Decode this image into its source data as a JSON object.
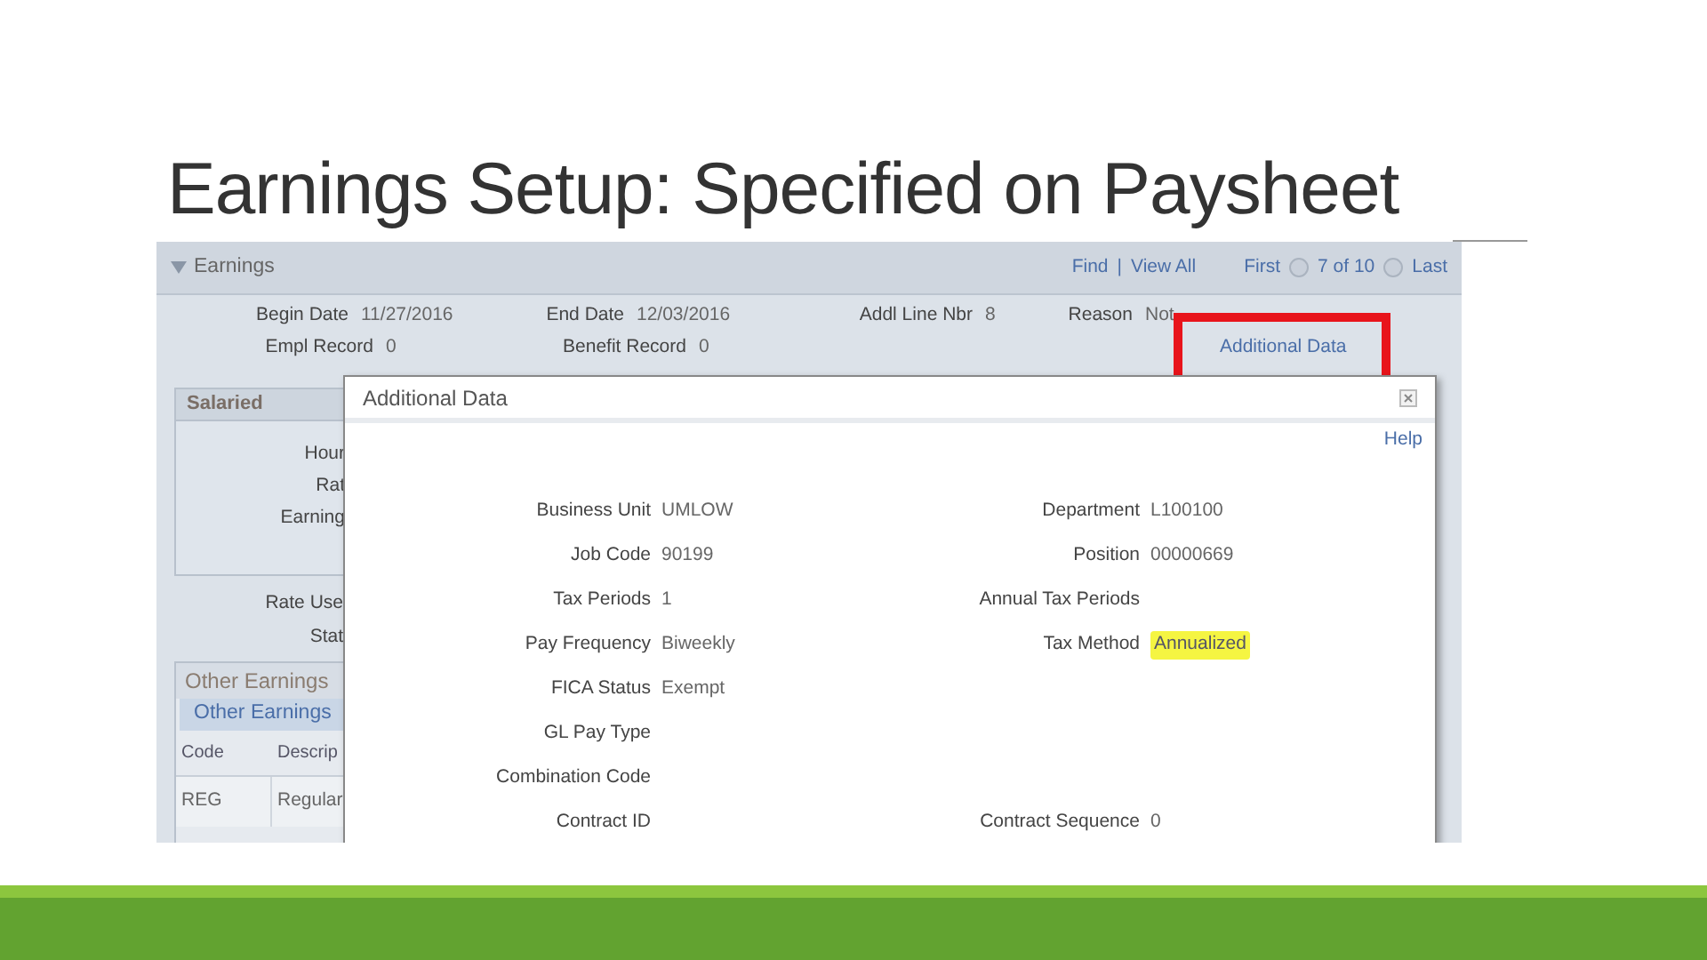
{
  "slide": {
    "title": "Earnings Setup: Specified on Paysheet"
  },
  "screenshot": {
    "section": {
      "title": "Earnings",
      "expanded": true,
      "nav": {
        "find": "Find",
        "separator": "|",
        "view_all": "View All",
        "first": "First",
        "position": "7 of 10",
        "last": "Last"
      }
    },
    "info_rows": [
      [
        {
          "label": "Begin Date",
          "value": "11/27/2016"
        },
        {
          "label": "End Date",
          "value": "12/03/2016"
        },
        {
          "label": "Addl Line Nbr",
          "value": "8"
        },
        {
          "label": "Reason",
          "value": "Not"
        }
      ],
      [
        {
          "label": "Empl Record",
          "value": "0"
        },
        {
          "label": "Benefit Record",
          "value": "0"
        }
      ]
    ],
    "additional_data_link": {
      "label": "Additional Data",
      "annotated": true
    },
    "salaried": {
      "title": "Salaried",
      "labels": [
        "Hour",
        "Rat",
        "Earning"
      ]
    },
    "rate_labels": [
      "Rate Use",
      "Stat"
    ],
    "other_earnings": {
      "title": "Other Earnings",
      "tab": "Other Earnings",
      "columns": [
        "Code",
        "Descrip"
      ],
      "rows": [
        [
          "REG",
          "Regular"
        ]
      ]
    },
    "dialog": {
      "title": "Additional Data",
      "help": "Help",
      "rows": [
        {
          "left": {
            "label": "Business Unit",
            "value": "UMLOW"
          },
          "right": {
            "label": "Department",
            "value": "L100100"
          }
        },
        {
          "left": {
            "label": "Job Code",
            "value": "90199"
          },
          "right": {
            "label": "Position",
            "value": "00000669"
          }
        },
        {
          "left": {
            "label": "Tax Periods",
            "value": "1"
          },
          "right": {
            "label": "Annual Tax Periods"
          }
        },
        {
          "left": {
            "label": "Pay Frequency",
            "value": "Biweekly"
          },
          "right": {
            "label": "Tax Method",
            "value": "Annualized",
            "highlighted": true
          }
        },
        {
          "left": {
            "label": "FICA Status",
            "value": "Exempt"
          }
        },
        {
          "left": {
            "label": "GL Pay Type"
          }
        },
        {
          "left": {
            "label": "Combination Code"
          }
        },
        {
          "left": {
            "label": "Contract ID"
          },
          "right": {
            "label": "Contract Sequence",
            "value": "0"
          }
        }
      ]
    }
  }
}
